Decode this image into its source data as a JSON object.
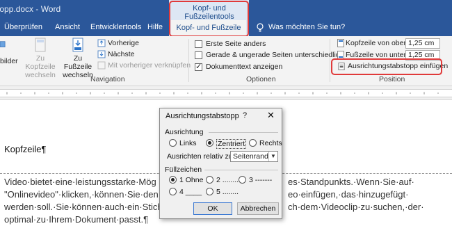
{
  "window": {
    "doc_title": "topp.docx - Word",
    "context_title": "Kopf- und Fußzeilentools"
  },
  "tabs": {
    "items": [
      "Überprüfen",
      "Ansicht",
      "Entwicklertools",
      "Hilfe"
    ],
    "active": "Kopf- und Fußzeile",
    "tell_me": "Was möchten Sie tun?"
  },
  "ribbon": {
    "bilder_label": "bilder",
    "zu_kopfzeile_label": "Zu Kopfzeile wechseln",
    "zu_fusszeile_label": "Zu Fußzeile wechseln",
    "vorherige_label": "Vorherige",
    "naechste_label": "Nächste",
    "verknuepfen_label": "Mit vorheriger verknüpfen",
    "navigation_group": "Navigation",
    "erste_seite_label": "Erste Seite anders",
    "gerade_label": "Gerade & ungerade Seiten unterschiedlich",
    "dokumenttext_label": "Dokumenttext anzeigen",
    "optionen_group": "Optionen",
    "kopfzeile_oben_label": "Kopfzeile von oben:",
    "kopfzeile_oben_value": "1,25 cm",
    "fusszeile_unten_label": "Fußzeile von unten:",
    "fusszeile_unten_value": "1,25 cm",
    "tabstopp_button_label": "Ausrichtungstabstopp einfügen",
    "position_group": "Position"
  },
  "document": {
    "header_text": "Kopfzeile¶",
    "body_lines": [
      "Video·bietet·eine·leistungsstarke·Mög",
      "\"Onlinevideo\"·klicken,·können·Sie·den",
      "werden·soll.·Sie·können·auch·ein·Stich",
      "optimal·zu·Ihrem·Dokument·passt.¶"
    ],
    "body_right_lines": [
      "es·Standpunkts.·Wenn·Sie·auf·",
      "eo·einfügen,·das·hinzugefügt·",
      "ch·dem·Videoclip·zu·suchen,·der·",
      ""
    ]
  },
  "dialog": {
    "title": "Ausrichtungstabstopp",
    "help": "?",
    "close": "✕",
    "ausrichtung_label": "Ausrichtung",
    "links_label": "Links",
    "zentriert_label": "Zentriert",
    "rechts_label": "Rechts",
    "relativ_label": "Ausrichten relativ zu:",
    "relativ_value": "Seitenrand",
    "fuellzeichen_label": "Füllzeichen",
    "fill_1": "1 Ohne",
    "fill_2": "2 .........",
    "fill_3": "3 -------",
    "fill_4": "4 ____",
    "fill_5": "5 ........",
    "ok_label": "OK",
    "cancel_label": "Abbrechen"
  }
}
